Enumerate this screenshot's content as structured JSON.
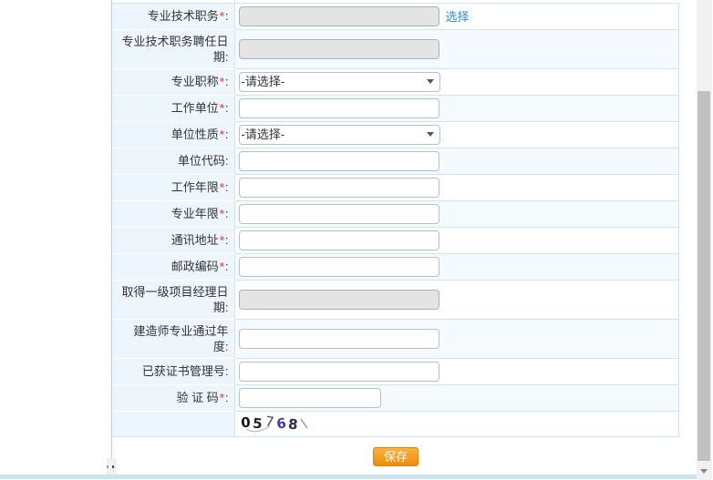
{
  "page": {
    "save_button": "保存",
    "colon": ":",
    "required_mark": "*"
  },
  "captcha": {
    "text": "05768"
  },
  "colors": {
    "link": "#2e8bd8",
    "button_orange": "#f08b0c",
    "required_red": "#ff5d5d",
    "row_alt_blue": "#f5fafe",
    "label_bg": "#eef6fd",
    "row_border": "#cfe4f5"
  },
  "form": {
    "rows": [
      {
        "id": "professional-tech-position",
        "label": "专业技术职务",
        "required": true,
        "control": "textbox",
        "disabled": true,
        "value": "",
        "link": "选择"
      },
      {
        "id": "tech-position-appoint-date",
        "label": "专业技术职务聘任日\n期",
        "required": false,
        "control": "textbox",
        "disabled": true,
        "value": ""
      },
      {
        "id": "professional-title",
        "label": "专业职称",
        "required": true,
        "control": "select",
        "value": "-请选择-"
      },
      {
        "id": "work-unit",
        "label": "工作单位",
        "required": true,
        "control": "textbox",
        "disabled": false,
        "value": ""
      },
      {
        "id": "unit-type",
        "label": "单位性质",
        "required": true,
        "control": "select",
        "value": "-请选择-"
      },
      {
        "id": "unit-code",
        "label": "单位代码",
        "required": false,
        "control": "textbox",
        "disabled": false,
        "value": ""
      },
      {
        "id": "work-years",
        "label": "工作年限",
        "required": true,
        "control": "textbox",
        "disabled": false,
        "value": ""
      },
      {
        "id": "professional-years",
        "label": "专业年限",
        "required": true,
        "control": "textbox",
        "disabled": false,
        "value": ""
      },
      {
        "id": "mailing-address",
        "label": "通讯地址",
        "required": true,
        "control": "textbox",
        "disabled": false,
        "value": ""
      },
      {
        "id": "postal-code",
        "label": "邮政编码",
        "required": true,
        "control": "textbox",
        "disabled": false,
        "value": ""
      },
      {
        "id": "first-class-pm-date",
        "label": "取得一级项目经理日\n期",
        "required": false,
        "control": "textbox",
        "disabled": true,
        "value": ""
      },
      {
        "id": "constructor-major-pass-year",
        "label": "建造师专业通过年\n度",
        "required": false,
        "control": "textbox",
        "disabled": false,
        "value": ""
      },
      {
        "id": "obtained-certificate-number",
        "label": "已获证书管理号",
        "required": false,
        "control": "textbox",
        "disabled": false,
        "value": ""
      },
      {
        "id": "captcha-code",
        "label": "验 证 码",
        "required": true,
        "control": "textbox",
        "disabled": false,
        "value": "",
        "narrow": true
      },
      {
        "id": "captcha-image",
        "label": "",
        "required": false,
        "control": "captcha"
      }
    ]
  }
}
